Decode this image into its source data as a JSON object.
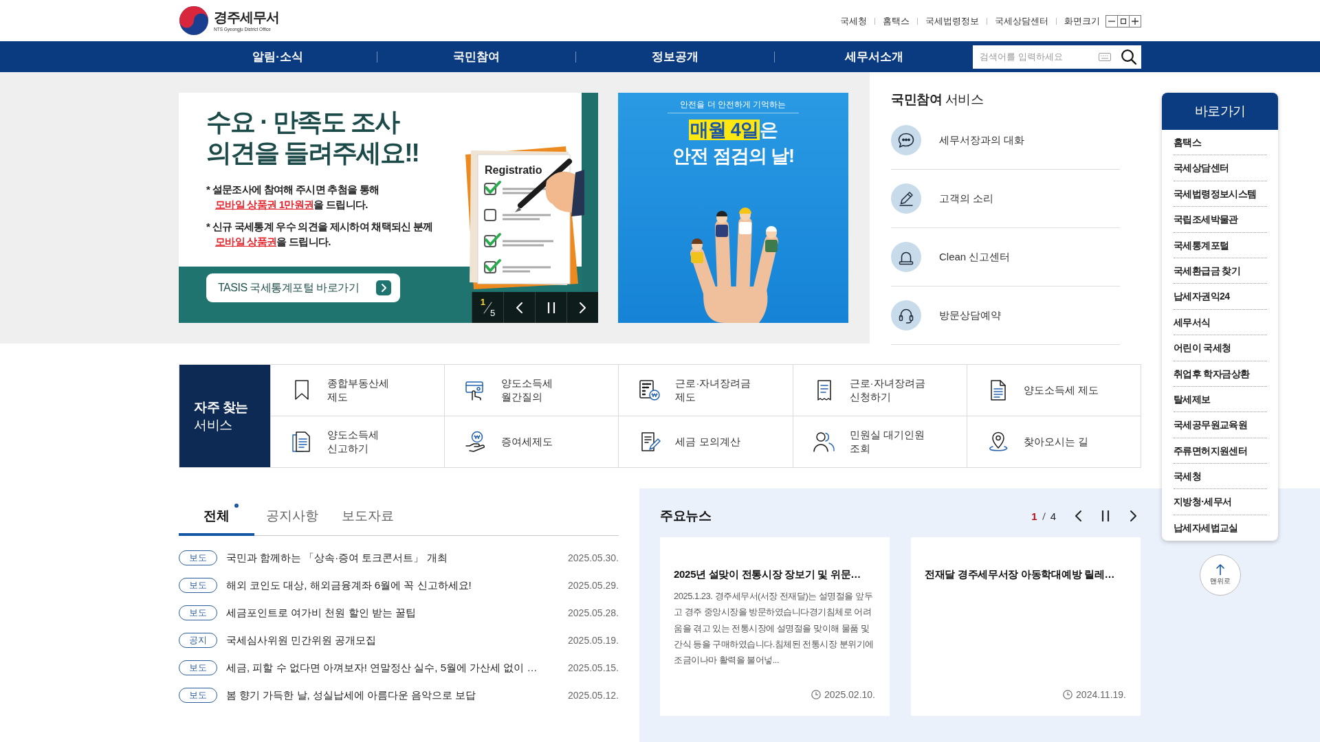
{
  "header": {
    "logo": {
      "title": "경주세무서",
      "subtitle": "NTS Gyeongju District Office"
    },
    "top_links": [
      "국세청",
      "홈택스",
      "국세법령정보",
      "국세상담센터"
    ],
    "font_size_label": "화면크기"
  },
  "nav": {
    "items": [
      "알림·소식",
      "국민참여",
      "정보공개",
      "세무서소개"
    ],
    "search": {
      "placeholder": "검색어를 입력하세요"
    }
  },
  "banners": [
    {
      "kind": "survey",
      "headline": "수요 · 만족도 조사\n의견을 들려주세요!!",
      "notes": [
        "* 설문조사에 참여해 주시면 추첨을 통해\n**모바일 상품권 1만원권**을 드립니다.",
        "* 신규 국세통계 우수 의견을 제시하여 채택되신 분께\n**모바일 상품권**을 드립니다."
      ],
      "illustration_label": "Registratio",
      "button": "TASIS 국세통계포털 바로가기",
      "pager": {
        "current": "1",
        "total": "5"
      }
    },
    {
      "kind": "safety",
      "kicker": "안전을 더 안전하게 기억하는",
      "headline": "**매월 4일**은\n안전 점검의 날!"
    }
  ],
  "participation": {
    "title": "**국민참여** 서비스",
    "items": [
      "세무서장과의 대화",
      "고객의 소리",
      "Clean 신고센터",
      "방문상담예약"
    ]
  },
  "frequent_services": {
    "title": "**자주 찾는**\n서비스",
    "items": [
      "종합부동산세\n제도",
      "양도소득세\n월간질의",
      "근로·자녀장려금\n제도",
      "근로·자녀장려금\n신청하기",
      "양도소득세 제도",
      "양도소득세\n신고하기",
      "증여세제도",
      "세금 모의계산",
      "민원실 대기인원\n조회",
      "찾아오시는 길"
    ]
  },
  "news": {
    "tabs": [
      {
        "label": "전체",
        "selected": true
      },
      {
        "label": "공지사항",
        "selected": false
      },
      {
        "label": "보도자료",
        "selected": false
      }
    ],
    "items": [
      {
        "category": "보도",
        "title": "국민과 함께하는 「상속·증여 토크콘서트」 개최",
        "date": "2025.05.30."
      },
      {
        "category": "보도",
        "title": "해외 코인도 대상, 해외금융계좌 6월에 꼭 신고하세요!",
        "date": "2025.05.29."
      },
      {
        "category": "보도",
        "title": "세금포인트로 여가비 천원 할인 받는 꿀팁",
        "date": "2025.05.28."
      },
      {
        "category": "공지",
        "title": "국세심사위원 민간위원 공개모집",
        "date": "2025.05.19."
      },
      {
        "category": "보도",
        "title": "세금, 피할 수 없다면 아껴보자! 연말정산 실수, 5월에 가산세 없이 …",
        "date": "2025.05.15."
      },
      {
        "category": "보도",
        "title": "봄 향기 가득한 날, 성실납세에 아름다운 음악으로 보답",
        "date": "2025.05.12."
      }
    ]
  },
  "main_news": {
    "title": "주요뉴스",
    "pager": {
      "current": "1",
      "total": "4"
    },
    "cards": [
      {
        "title": "2025년 설맞이 전통시장 장보기 및 위문…",
        "summary": "2025.1.23. 경주세무서(서장 전재달)는 설명절을 앞두고 경주 중앙시장을 방문하였습니다경기침체로 어려움을 겪고 있는 전통시장에 설명절을 맞이해 물품 및 간식 등을 구매하였습니다.침체된 전통시장 분위기에 조금이나마 활력을 불어넣...",
        "date": "2025.02.10."
      },
      {
        "title": "전재달 경주세무서장 아동학대예방 릴레…",
        "date": "2024.11.19."
      }
    ]
  },
  "quick_links": {
    "title": "바로가기",
    "items": [
      "홈택스",
      "국세상담센터",
      "국세법령정보시스템",
      "국립조세박물관",
      "국세통계포털",
      "국세환급금 찾기",
      "납세자권익24",
      "세무서식",
      "어린이 국세청",
      "취업후 학자금상환",
      "탈세제보",
      "국세공무원교육원",
      "주류면허지원센터",
      "국세청",
      "지방청·세무서",
      "납세자세법교실"
    ]
  },
  "top_button": {
    "label": "맨위로"
  }
}
